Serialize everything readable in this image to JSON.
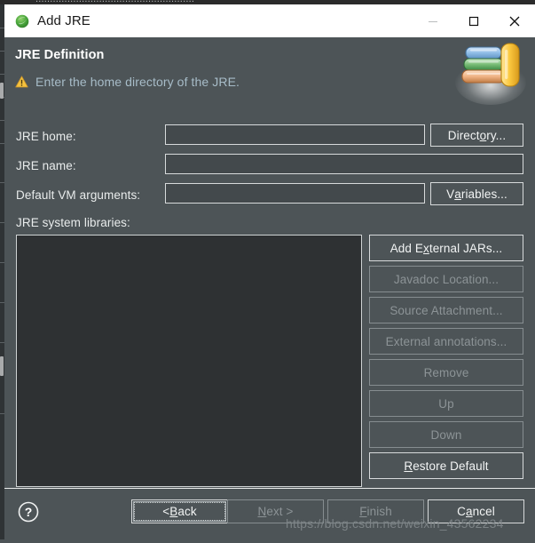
{
  "window": {
    "title": "Add JRE",
    "icon": "eclipse-jre-icon",
    "controls": {
      "minimize": "minimize-icon",
      "maximize": "maximize-icon",
      "close": "close-icon"
    }
  },
  "header": {
    "title": "JRE Definition",
    "status_icon": "warning-icon",
    "message": "Enter the home directory of the JRE.",
    "banner_icon": "books-stack-icon",
    "message_color": "#a7bcc8",
    "background_color": "#4d5457"
  },
  "form": {
    "jre_home": {
      "label": "JRE home:",
      "value": "",
      "placeholder": ""
    },
    "jre_name": {
      "label": "JRE name:",
      "value": "",
      "placeholder": ""
    },
    "default_vm_arguments": {
      "label": "Default VM arguments:",
      "value": "",
      "placeholder": ""
    },
    "directory_button": {
      "label_pre": "Direct",
      "label_mnemonic": "o",
      "label_post": "ry..."
    },
    "variables_button": {
      "label_pre": "V",
      "label_mnemonic": "a",
      "label_post": "riables..."
    },
    "libraries_label": "JRE system libraries:",
    "libraries_items": []
  },
  "side_buttons": [
    {
      "name": "add-external-jars",
      "label_pre": "Add E",
      "label_mnemonic": "x",
      "label_post": "ternal JARs...",
      "enabled": true
    },
    {
      "name": "javadoc-location",
      "label_pre": "Javadoc Location...",
      "label_mnemonic": "",
      "label_post": "",
      "enabled": false
    },
    {
      "name": "source-attachment",
      "label_pre": "Source Attachment...",
      "label_mnemonic": "",
      "label_post": "",
      "enabled": false
    },
    {
      "name": "external-annotations",
      "label_pre": "External annotations...",
      "label_mnemonic": "",
      "label_post": "",
      "enabled": false
    },
    {
      "name": "remove",
      "label_pre": "Remove",
      "label_mnemonic": "",
      "label_post": "",
      "enabled": false
    },
    {
      "name": "up",
      "label_pre": "Up",
      "label_mnemonic": "",
      "label_post": "",
      "enabled": false
    },
    {
      "name": "down",
      "label_pre": "Down",
      "label_mnemonic": "",
      "label_post": "",
      "enabled": false
    },
    {
      "name": "restore-default",
      "label_pre": "",
      "label_mnemonic": "R",
      "label_post": "estore Default",
      "enabled": true
    }
  ],
  "footer": {
    "help_icon": "help-question-icon",
    "back_button": {
      "label_pre": "< ",
      "label_mnemonic": "B",
      "label_post": "ack",
      "enabled": true,
      "focused": true
    },
    "next_button": {
      "label_pre": "",
      "label_mnemonic": "N",
      "label_post": "ext >",
      "enabled": false
    },
    "finish_button": {
      "label_pre": "",
      "label_mnemonic": "F",
      "label_post": "inish",
      "enabled": false
    },
    "cancel_button": {
      "label_pre": "C",
      "label_mnemonic": "a",
      "label_post": "ncel",
      "enabled": true
    }
  },
  "watermark": "https://blog.csdn.net/weixin_43562234",
  "background_strip_text": "......................................................."
}
